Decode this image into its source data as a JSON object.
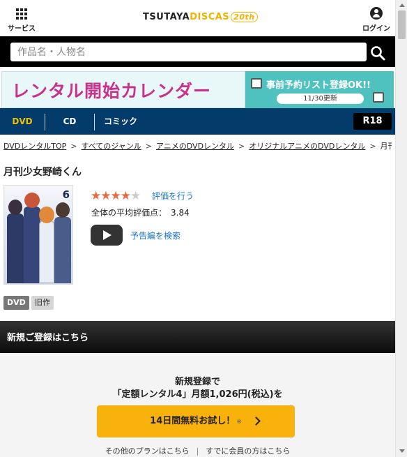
{
  "header": {
    "services_label": "サービス",
    "logo": {
      "part1": "TSUTAYA",
      "part2": "DISCAS",
      "badge": "20th"
    },
    "login_label": "ログイン"
  },
  "search": {
    "placeholder": "作品名・人物名",
    "value": ""
  },
  "banner": {
    "title": "レンタル開始カレンダー",
    "promo": "事前予約リスト登録OK!!",
    "updated": "11/30更新"
  },
  "nav": {
    "tabs": [
      {
        "label": "DVD",
        "active": true
      },
      {
        "label": "CD",
        "active": false
      },
      {
        "label": "コミック",
        "active": false
      }
    ],
    "r18": "R18"
  },
  "breadcrumb": [
    "DVDレンタルTOP",
    "すべてのジャンル",
    "アニメのDVDレンタル",
    "オリジナルアニメのDVDレンタル",
    "月刊少女野崎くん"
  ],
  "product": {
    "title": "月刊少女野崎くん",
    "cover_volume": "6",
    "rating": {
      "stars": 4,
      "max": 5,
      "rate_link": "評価を行う",
      "avg_label": "全体の平均評価点：",
      "avg_value": "3.84"
    },
    "trailer_label": "予告編を検索",
    "tags": [
      "DVD",
      "旧作"
    ]
  },
  "register": {
    "heading": "新規ご登録はこちら",
    "line1": "新規登録で",
    "line2": "「定額レンタル4」月額1,026円(税込)を",
    "cta": "14日間無料お試し！",
    "cta_note": "※",
    "other_plans": "その他のプランはこちら",
    "member_link": "すでに会員の方はこちら"
  },
  "colors": {
    "nav_bg": "#033b6b",
    "active_tab": "#f0c000",
    "cta": "#f9b10b",
    "link": "#1a73c7",
    "star": "#e86a3f"
  }
}
